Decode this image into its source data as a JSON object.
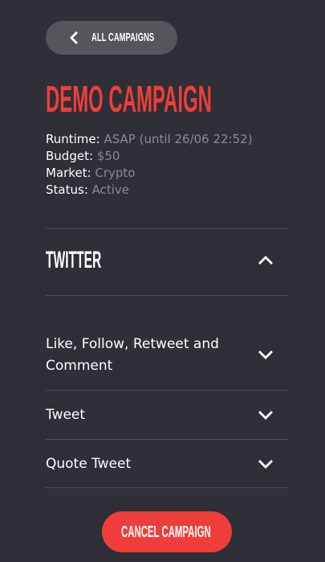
{
  "back_button": {
    "label": "ALL CAMPAIGNS",
    "icon": "chevron-left-icon"
  },
  "campaign": {
    "title": "DEMO CAMPAIGN",
    "info": [
      {
        "key": "Runtime",
        "value": "ASAP (until 26/06 22:52)"
      },
      {
        "key": "Budget",
        "value": "$50"
      },
      {
        "key": "Market",
        "value": "Crypto"
      },
      {
        "key": "Status",
        "value": "Active"
      }
    ]
  },
  "section": {
    "title": "TWITTER",
    "expanded": true,
    "icon": "chevron-up-icon",
    "tasks": [
      {
        "label": "Like, Follow, Retweet and Comment",
        "icon": "chevron-down-icon"
      },
      {
        "label": "Tweet",
        "icon": "chevron-down-icon"
      },
      {
        "label": "Quote Tweet",
        "icon": "chevron-down-icon"
      }
    ]
  },
  "cancel_button": {
    "label": "CANCEL CAMPAIGN"
  },
  "colors": {
    "background": "#2f2f37",
    "accent": "#ef3e3a",
    "muted_text": "#8a8a92",
    "pill": "#55555c",
    "divider": "#4d4d56"
  }
}
